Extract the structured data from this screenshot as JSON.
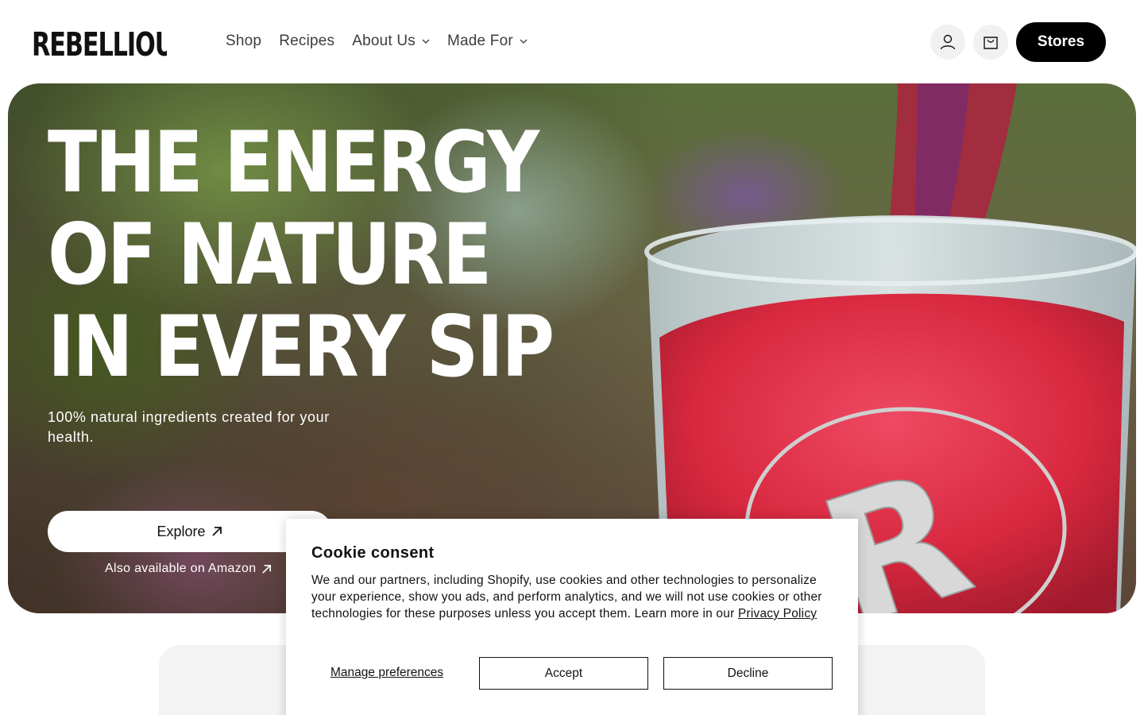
{
  "brand": {
    "logo_text": "REBELLIOUS"
  },
  "nav": {
    "items": [
      {
        "label": "Shop",
        "has_dropdown": false
      },
      {
        "label": "Recipes",
        "has_dropdown": false
      },
      {
        "label": "About Us",
        "has_dropdown": true
      },
      {
        "label": "Made For",
        "has_dropdown": true
      }
    ]
  },
  "header": {
    "account_icon": "user-icon",
    "cart_icon": "shopping-bag-icon",
    "stores_label": "Stores"
  },
  "hero": {
    "title": "THE ENERGY OF NATURE IN EVERY SIP",
    "subtitle": "100% natural ingredients created for your health.",
    "explore_label": "Explore",
    "amazon_label": "Also available on Amazon"
  },
  "cookie": {
    "title": "Cookie consent",
    "text": "We and our partners, including Shopify, use cookies and other technologies to personalize your experience, show you ads, and perform analytics, and we will not use cookies or other technologies for these purposes unless you accept them. Learn more in our",
    "privacy_link": "Privacy Policy",
    "manage_label": "Manage preferences",
    "accept_label": "Accept",
    "decline_label": "Decline"
  },
  "colors": {
    "primary": "#000000",
    "background": "#ffffff",
    "drink_red": "#d8283f"
  }
}
